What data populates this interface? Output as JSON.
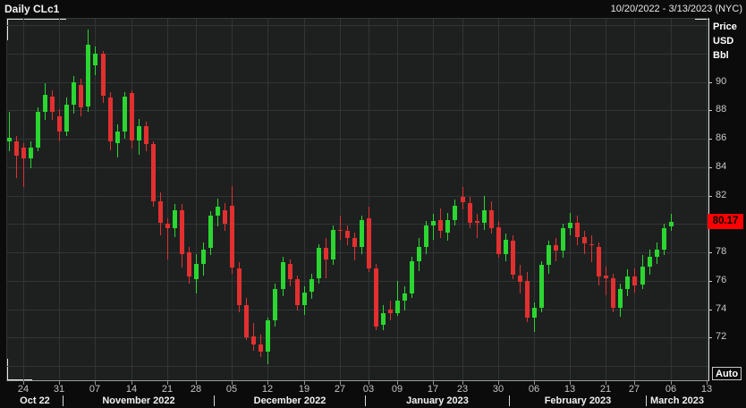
{
  "window": {
    "title": "Daily CLc1",
    "date_range": "10/20/2022 - 3/13/2023 (NYC)"
  },
  "price_axis": {
    "unit": [
      "Price",
      "USD",
      "Bbl"
    ],
    "tick_labels": [
      "90",
      "88",
      "86",
      "84",
      "82",
      "78",
      "76",
      "74",
      "72"
    ],
    "tick_values": [
      90,
      88,
      86,
      84,
      82,
      78,
      76,
      74,
      72
    ],
    "last_price": "80.17",
    "auto_button": "Auto"
  },
  "time_axis": {
    "day_ticks": [
      {
        "t": "24",
        "i": 2
      },
      {
        "t": "31",
        "i": 7
      },
      {
        "t": "07",
        "i": 12
      },
      {
        "t": "14",
        "i": 17
      },
      {
        "t": "21",
        "i": 22
      },
      {
        "t": "28",
        "i": 26
      },
      {
        "t": "05",
        "i": 31
      },
      {
        "t": "12",
        "i": 36
      },
      {
        "t": "19",
        "i": 41
      },
      {
        "t": "27",
        "i": 46
      },
      {
        "t": "03",
        "i": 50
      },
      {
        "t": "09",
        "i": 54
      },
      {
        "t": "17",
        "i": 59
      },
      {
        "t": "23",
        "i": 63
      },
      {
        "t": "30",
        "i": 68
      },
      {
        "t": "06",
        "i": 73
      },
      {
        "t": "13",
        "i": 78
      },
      {
        "t": "21",
        "i": 83
      },
      {
        "t": "27",
        "i": 87
      },
      {
        "t": "06",
        "i": 92
      },
      {
        "t": "13",
        "i": 97
      }
    ],
    "months": [
      {
        "label": "Oct 22",
        "start": -1
      },
      {
        "label": "November 2022",
        "start": 8
      },
      {
        "label": "December 2022",
        "start": 29
      },
      {
        "label": "January 2023",
        "start": 50
      },
      {
        "label": "February 2023",
        "start": 70
      },
      {
        "label": "March 2023",
        "start": 89
      }
    ]
  },
  "chart_data": {
    "type": "candlestick",
    "symbol": "CLc1",
    "interval": "Daily",
    "title": "Daily CLc1",
    "y_axis_unit": "Price USD Bbl",
    "visible_price_range": [
      69.0,
      94.45
    ],
    "grid": true,
    "last_price": 80.17,
    "columns": [
      "date",
      "open",
      "high",
      "low",
      "close"
    ],
    "candles": [
      [
        "2022-10-20",
        85.8,
        87.9,
        85.1,
        86.1
      ],
      [
        "2022-10-21",
        85.8,
        86.2,
        83.2,
        84.8
      ],
      [
        "2022-10-24",
        85.4,
        85.7,
        82.6,
        84.6
      ],
      [
        "2022-10-25",
        84.6,
        85.8,
        83.9,
        85.4
      ],
      [
        "2022-10-26",
        85.4,
        88.2,
        85.1,
        87.9
      ],
      [
        "2022-10-27",
        87.9,
        89.9,
        87.3,
        89.1
      ],
      [
        "2022-10-28",
        89.0,
        89.4,
        87.3,
        87.9
      ],
      [
        "2022-10-31",
        87.6,
        88.1,
        85.8,
        86.5
      ],
      [
        "2022-11-01",
        86.5,
        88.9,
        86.2,
        88.4
      ],
      [
        "2022-11-02",
        88.4,
        90.4,
        87.8,
        90.0
      ],
      [
        "2022-11-03",
        89.8,
        90.2,
        87.6,
        88.2
      ],
      [
        "2022-11-04",
        88.3,
        93.7,
        87.9,
        92.6
      ],
      [
        "2022-11-07",
        91.2,
        92.5,
        90.5,
        92.0
      ],
      [
        "2022-11-08",
        92.0,
        92.2,
        88.5,
        89.0
      ],
      [
        "2022-11-09",
        88.9,
        89.3,
        85.2,
        85.8
      ],
      [
        "2022-11-10",
        85.7,
        87.0,
        84.7,
        86.5
      ],
      [
        "2022-11-11",
        86.5,
        89.3,
        86.0,
        89.0
      ],
      [
        "2022-11-14",
        89.2,
        89.4,
        85.3,
        85.9
      ],
      [
        "2022-11-15",
        85.9,
        87.4,
        84.9,
        86.9
      ],
      [
        "2022-11-16",
        86.9,
        87.2,
        85.1,
        85.6
      ],
      [
        "2022-11-17",
        85.6,
        85.8,
        81.2,
        81.6
      ],
      [
        "2022-11-18",
        81.6,
        82.2,
        79.2,
        80.1
      ],
      [
        "2022-11-21",
        80.0,
        80.4,
        77.5,
        79.7
      ],
      [
        "2022-11-22",
        79.7,
        81.4,
        79.1,
        81.0
      ],
      [
        "2022-11-23",
        81.0,
        81.4,
        76.9,
        77.9
      ],
      [
        "2022-11-25",
        78.0,
        78.4,
        75.8,
        76.3
      ],
      [
        "2022-11-28",
        76.1,
        77.9,
        75.1,
        77.2
      ],
      [
        "2022-11-29",
        77.2,
        78.7,
        76.4,
        78.2
      ],
      [
        "2022-11-30",
        78.3,
        80.9,
        77.8,
        80.6
      ],
      [
        "2022-12-01",
        80.6,
        81.8,
        79.8,
        81.2
      ],
      [
        "2022-12-02",
        81.0,
        81.5,
        79.5,
        80.0
      ],
      [
        "2022-12-05",
        81.3,
        82.7,
        76.5,
        76.9
      ],
      [
        "2022-12-06",
        76.9,
        77.3,
        73.8,
        74.3
      ],
      [
        "2022-12-07",
        74.3,
        74.8,
        71.8,
        72.0
      ],
      [
        "2022-12-08",
        72.1,
        73.0,
        71.1,
        71.5
      ],
      [
        "2022-12-09",
        71.5,
        72.2,
        70.6,
        71.0
      ],
      [
        "2022-12-12",
        71.0,
        73.4,
        70.1,
        73.2
      ],
      [
        "2022-12-13",
        73.2,
        75.8,
        72.8,
        75.4
      ],
      [
        "2022-12-14",
        75.4,
        77.7,
        74.9,
        77.3
      ],
      [
        "2022-12-15",
        77.2,
        77.5,
        75.6,
        76.1
      ],
      [
        "2022-12-16",
        76.1,
        76.4,
        73.9,
        74.3
      ],
      [
        "2022-12-19",
        74.3,
        75.6,
        73.6,
        75.2
      ],
      [
        "2022-12-20",
        75.2,
        76.5,
        74.7,
        76.1
      ],
      [
        "2022-12-21",
        76.2,
        78.6,
        75.8,
        78.3
      ],
      [
        "2022-12-22",
        78.3,
        79.0,
        76.2,
        77.5
      ],
      [
        "2022-12-23",
        77.5,
        79.9,
        77.1,
        79.6
      ],
      [
        "2022-12-27",
        79.6,
        80.6,
        78.9,
        79.5
      ],
      [
        "2022-12-28",
        79.5,
        79.9,
        78.5,
        79.0
      ],
      [
        "2022-12-29",
        79.0,
        79.4,
        77.4,
        78.4
      ],
      [
        "2022-12-30",
        78.4,
        80.6,
        77.9,
        80.3
      ],
      [
        "2023-01-03",
        80.4,
        81.2,
        76.6,
        76.9
      ],
      [
        "2023-01-04",
        76.9,
        77.2,
        72.5,
        72.8
      ],
      [
        "2023-01-05",
        72.9,
        74.3,
        72.5,
        73.7
      ],
      [
        "2023-01-06",
        74.0,
        74.6,
        73.2,
        73.7
      ],
      [
        "2023-01-09",
        73.7,
        76.0,
        73.5,
        74.6
      ],
      [
        "2023-01-10",
        74.6,
        75.6,
        73.9,
        75.1
      ],
      [
        "2023-01-11",
        75.1,
        77.7,
        74.8,
        77.4
      ],
      [
        "2023-01-12",
        77.4,
        79.0,
        76.7,
        78.4
      ],
      [
        "2023-01-13",
        78.4,
        80.2,
        77.9,
        79.9
      ],
      [
        "2023-01-17",
        79.9,
        80.7,
        78.9,
        80.2
      ],
      [
        "2023-01-18",
        80.3,
        81.1,
        79.0,
        79.5
      ],
      [
        "2023-01-19",
        79.4,
        80.8,
        78.8,
        80.3
      ],
      [
        "2023-01-20",
        80.3,
        81.7,
        79.9,
        81.3
      ],
      [
        "2023-01-23",
        81.9,
        82.6,
        81.0,
        81.5
      ],
      [
        "2023-01-24",
        81.5,
        81.9,
        79.7,
        80.1
      ],
      [
        "2023-01-25",
        80.2,
        80.7,
        79.0,
        80.1
      ],
      [
        "2023-01-26",
        80.1,
        82.0,
        79.6,
        81.0
      ],
      [
        "2023-01-27",
        81.0,
        81.6,
        79.3,
        79.7
      ],
      [
        "2023-01-30",
        79.8,
        80.2,
        77.6,
        77.9
      ],
      [
        "2023-01-31",
        77.9,
        79.3,
        77.4,
        78.9
      ],
      [
        "2023-02-01",
        78.8,
        79.2,
        76.1,
        76.4
      ],
      [
        "2023-02-02",
        76.4,
        77.1,
        75.1,
        75.9
      ],
      [
        "2023-02-03",
        76.0,
        76.6,
        73.1,
        73.4
      ],
      [
        "2023-02-06",
        73.4,
        74.5,
        72.4,
        74.1
      ],
      [
        "2023-02-07",
        74.1,
        77.4,
        73.8,
        77.1
      ],
      [
        "2023-02-08",
        77.1,
        78.8,
        76.5,
        78.5
      ],
      [
        "2023-02-09",
        78.5,
        79.0,
        77.4,
        78.1
      ],
      [
        "2023-02-10",
        78.1,
        80.0,
        77.6,
        79.7
      ],
      [
        "2023-02-13",
        79.7,
        80.8,
        79.2,
        80.1
      ],
      [
        "2023-02-14",
        80.1,
        80.6,
        78.5,
        79.1
      ],
      [
        "2023-02-15",
        79.1,
        79.5,
        77.9,
        78.6
      ],
      [
        "2023-02-16",
        78.6,
        79.2,
        77.3,
        78.5
      ],
      [
        "2023-02-17",
        78.4,
        78.7,
        75.7,
        76.3
      ],
      [
        "2023-02-21",
        76.4,
        77.0,
        75.0,
        76.2
      ],
      [
        "2023-02-22",
        76.2,
        76.5,
        73.8,
        74.1
      ],
      [
        "2023-02-23",
        74.1,
        75.8,
        73.5,
        75.4
      ],
      [
        "2023-02-24",
        75.4,
        76.8,
        74.9,
        76.3
      ],
      [
        "2023-02-27",
        76.3,
        76.9,
        75.2,
        75.7
      ],
      [
        "2023-02-28",
        75.7,
        77.8,
        75.4,
        77.0
      ],
      [
        "2023-03-01",
        77.0,
        78.2,
        76.4,
        77.7
      ],
      [
        "2023-03-02",
        77.7,
        78.7,
        77.2,
        78.2
      ],
      [
        "2023-03-03",
        78.2,
        80.0,
        77.8,
        79.7
      ],
      [
        "2023-03-06",
        79.8,
        80.7,
        79.5,
        80.17
      ]
    ]
  },
  "colors": {
    "up": "#2bd631",
    "down": "#e23030",
    "last_price_bg": "#fe0000",
    "background": "#0b0b0b",
    "plot_background": "#1e2020",
    "grid": "#313535"
  }
}
